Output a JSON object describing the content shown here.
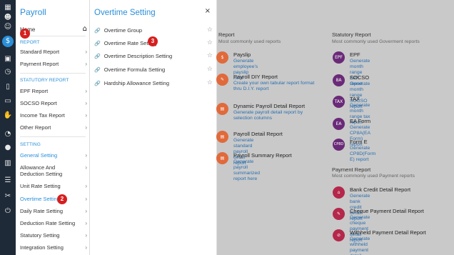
{
  "rail_icons": [
    "dashboard-icon",
    "users-icon",
    "payroll-icon",
    "calendar-icon",
    "clock-icon",
    "document-icon",
    "tablet-icon",
    "hand-icon",
    "timer-icon",
    "info-icon",
    "clipboard-icon",
    "list-icon",
    "tools-icon",
    "power-icon"
  ],
  "menu": {
    "title": "Payroll",
    "home": "Home",
    "report_section": "REPORT",
    "report_items": [
      "Standard Report",
      "Payment Report"
    ],
    "statutory_section": "STATUTORY REPORT",
    "statutory_items": [
      "EPF Report",
      "SOCSO Report",
      "Income Tax Report",
      "Other Report"
    ],
    "setting_section": "SETTING",
    "setting_items": [
      "General Setting",
      "Allowance And Deduction Setting",
      "Unit Rate Setting",
      "Overtime Setting",
      "Daily Rate Setting",
      "Deduction Rate Setting",
      "Statutory Setting",
      "Integration Setting"
    ]
  },
  "panel": {
    "title": "Overtime Setting",
    "close": "×",
    "items": [
      "Overtime Group",
      "Overtime Rate Setting",
      "Overtime Description Setting",
      "Overtime Formula Setting",
      "Hardship Allowance Setting"
    ]
  },
  "markers": [
    "1",
    "2",
    "3"
  ],
  "left_column": {
    "heading": "Report",
    "sub": "Most commonly used reports",
    "reports": [
      {
        "title": "Payslip",
        "desc": "Generate employee's payslip here",
        "icon": "$"
      },
      {
        "title": "Payroll DIY Report",
        "desc": "Create your own tabular report format thru D.I.Y. report",
        "icon": "✎"
      },
      {
        "title": "Dynamic Payroll Detail Report",
        "desc": "Generate payroll detail report by selection columns",
        "icon": "▤"
      },
      {
        "title": "Payroll Detail Report",
        "desc": "Generate standard payroll detail report",
        "icon": "▤"
      },
      {
        "title": "Payroll Summary Report",
        "desc": "Generate payroll summarized report here",
        "icon": "▤"
      }
    ]
  },
  "right_column": {
    "statutory_heading": "Statutory Report",
    "statutory_sub": "Most commonly used Goverment reports",
    "statutory_reports": [
      {
        "title": "EPF",
        "desc": "Generate month range EPF report",
        "icon": "EPF"
      },
      {
        "title": "SOCSO",
        "desc": "Generate month range SOCSO report",
        "icon": "8A"
      },
      {
        "title": "TAX",
        "desc": "Generate month range tax report",
        "icon": "TAX"
      },
      {
        "title": "EA Form",
        "desc": "Generate CP8A(EA Form) report",
        "icon": "EA"
      },
      {
        "title": "Form E",
        "desc": "Generate CP8D(Form E) report",
        "icon": "CP8D"
      }
    ],
    "payment_heading": "Payment Report",
    "payment_sub": "Most commonly used Payment reports",
    "payment_reports": [
      {
        "title": "Bank Credit Detail Report",
        "desc": "Generate bank credit detail report",
        "icon": "⌂"
      },
      {
        "title": "Cheque Payment Detail Report",
        "desc": "Generate cheque payment detail report",
        "icon": "✎"
      },
      {
        "title": "Withheld Payment Detail Report",
        "desc": "Generate withheld payment detail report",
        "icon": "⊘"
      }
    ]
  },
  "colors": {
    "accent": "#2a8fd8",
    "orange": "#e06a3b",
    "purple": "#6a2a78",
    "crimson": "#b4284b",
    "marker": "#d61f1f"
  }
}
